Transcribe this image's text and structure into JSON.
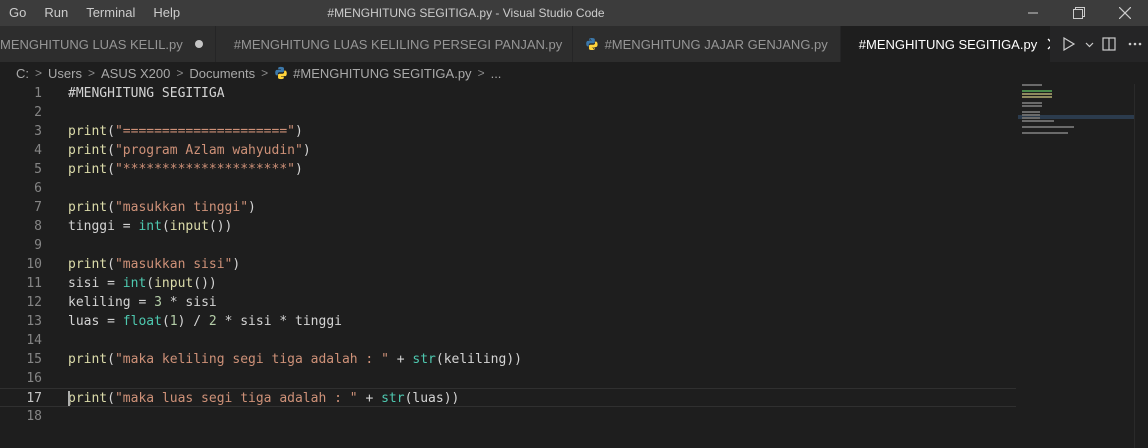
{
  "menu": [
    "Go",
    "Run",
    "Terminal",
    "Help"
  ],
  "window_title": "#MENGHITUNG SEGITIGA.py - Visual Studio Code",
  "tabs": [
    {
      "label": "MENGHITUNG LUAS KELIL.py",
      "modified": true,
      "icon": "python-icon"
    },
    {
      "label": "#MENGHITUNG LUAS KELILING PERSEGI PANJAN.py",
      "icon": "python-icon"
    },
    {
      "label": "#MENGHITUNG JAJAR GENJANG.py",
      "icon": "python-icon"
    },
    {
      "label": "#MENGHITUNG SEGITIGA.py",
      "active": true,
      "icon": "python-icon"
    }
  ],
  "breadcrumb": [
    "C:",
    "Users",
    "ASUS X200",
    "Documents",
    "#MENGHITUNG SEGITIGA.py",
    "..."
  ],
  "editor": {
    "current_line": 17,
    "line_numbers": [
      "1",
      "2",
      "3",
      "4",
      "5",
      "6",
      "7",
      "8",
      "9",
      "10",
      "11",
      "12",
      "13",
      "14",
      "15",
      "16",
      "17",
      "18"
    ],
    "lines": [
      "#MENGHITUNG SEGITIGA",
      "",
      "print(\"=====================\")",
      "print(\"program Azlam wahyudin\")",
      "print(\"*********************\")",
      "",
      "print(\"masukkan tinggi\")",
      "tinggi = int(input())",
      "",
      "print(\"masukkan sisi\")",
      "sisi = int(input())",
      "keliling = 3 * sisi",
      "luas = float(1) / 2 * sisi * tinggi",
      "",
      "print(\"maka keliling segi tiga adalah : \" + str(keliling))",
      "",
      "print(\"maka luas segi tiga adalah : \" + str(luas))",
      ""
    ]
  },
  "colors": {
    "background": "#1e1e1e",
    "titlebar": "#3c3c3c",
    "function": "#dcdcaa",
    "string": "#ce9178",
    "builtin_class": "#4ec9b0",
    "number": "#b5cea8"
  }
}
